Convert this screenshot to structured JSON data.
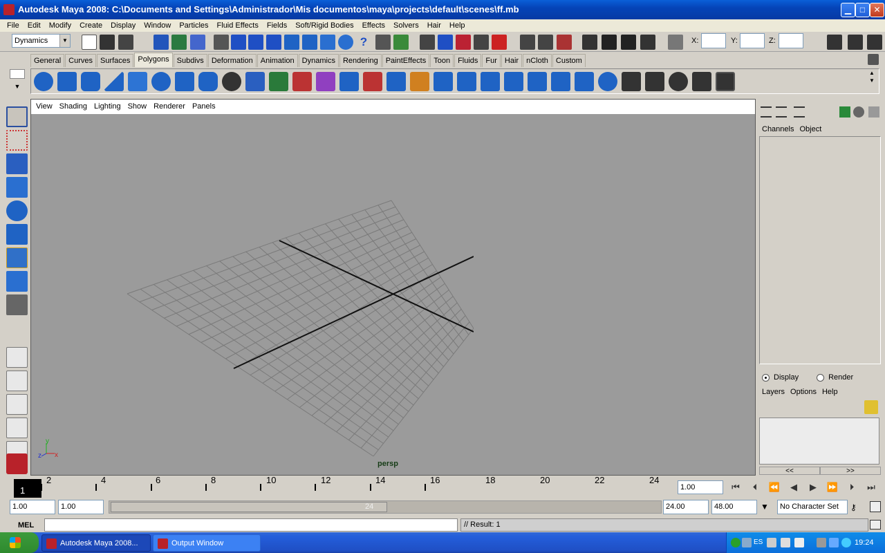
{
  "window": {
    "title": "Autodesk Maya 2008: C:\\Documents and Settings\\Administrador\\Mis documentos\\maya\\projects\\default\\scenes\\ff.mb"
  },
  "menubar": [
    "File",
    "Edit",
    "Modify",
    "Create",
    "Display",
    "Window",
    "Particles",
    "Fluid Effects",
    "Fields",
    "Soft/Rigid Bodies",
    "Effects",
    "Solvers",
    "Hair",
    "Help"
  ],
  "statusline": {
    "mode": "Dynamics",
    "x_label": "X:",
    "y_label": "Y:",
    "z_label": "Z:"
  },
  "shelf_tabs": [
    "General",
    "Curves",
    "Surfaces",
    "Polygons",
    "Subdivs",
    "Deformation",
    "Animation",
    "Dynamics",
    "Rendering",
    "PaintEffects",
    "Toon",
    "Fluids",
    "Fur",
    "Hair",
    "nCloth",
    "Custom"
  ],
  "shelf_active": "Polygons",
  "panel_menu": [
    "View",
    "Shading",
    "Lighting",
    "Show",
    "Renderer",
    "Panels"
  ],
  "viewport": {
    "camera": "persp",
    "axis_x": "x",
    "axis_y": "y",
    "axis_z": "z"
  },
  "channel_box": {
    "menu": [
      "Channels",
      "Object"
    ]
  },
  "layer_editor": {
    "display_label": "Display",
    "render_label": "Render",
    "mode": "Display",
    "menu": [
      "Layers",
      "Options",
      "Help"
    ],
    "scroll_left": "<<",
    "scroll_right": ">>"
  },
  "time_slider": {
    "current_frame": "1",
    "tick_labels": [
      "2",
      "4",
      "6",
      "8",
      "10",
      "12",
      "14",
      "16",
      "18",
      "20",
      "22",
      "24"
    ],
    "frame_field": "1.00"
  },
  "range_slider": {
    "start_time": "1.00",
    "start_playback": "1.00",
    "thumb_label": "24",
    "end_playback": "24.00",
    "end_time": "48.00",
    "character_set": "No Character Set"
  },
  "command_line": {
    "label": "MEL",
    "result": "// Result: 1"
  },
  "taskbar": {
    "items": [
      "Autodesk Maya 2008...",
      "Output Window"
    ],
    "language": "ES",
    "clock": "19:24"
  },
  "colors": {
    "titlebar": "#0544b8",
    "viewport_bg": "#9b9b9b",
    "shelf_icon": "#1f63c4",
    "taskbar": "#245edb"
  }
}
